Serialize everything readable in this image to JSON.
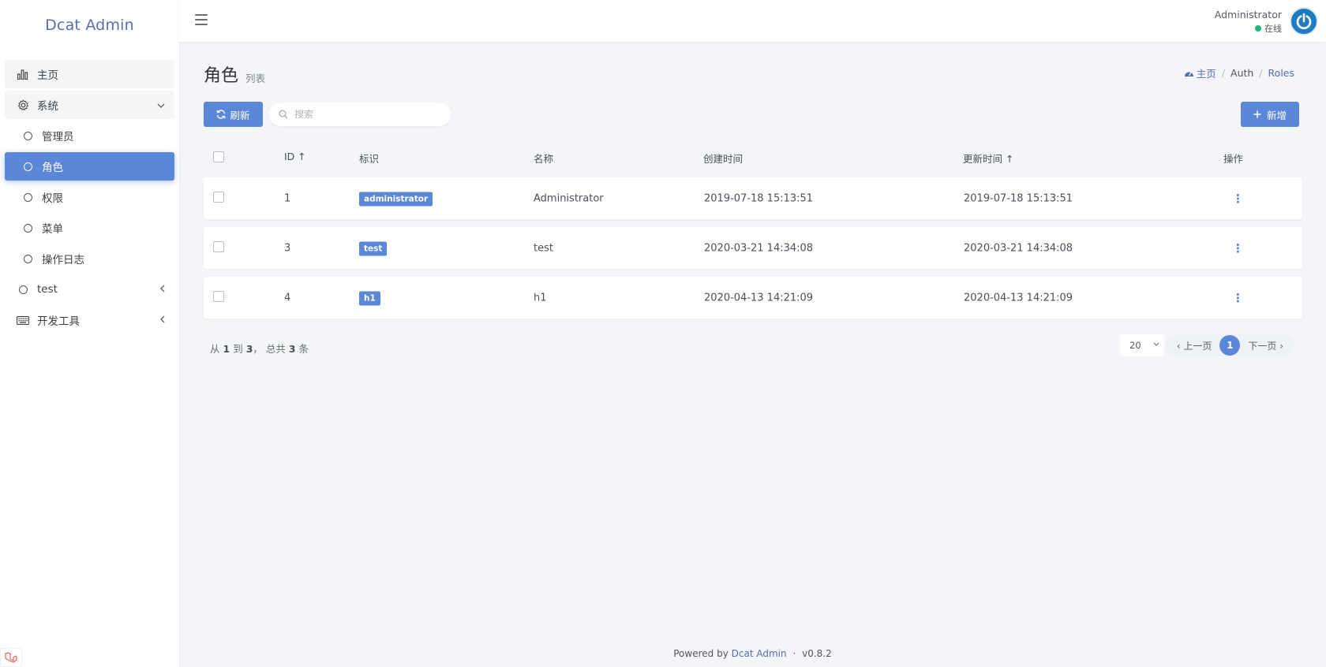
{
  "app": {
    "brand": "Dcat Admin"
  },
  "sidebar": {
    "items": [
      {
        "label": "主页",
        "icon": "bar-chart-icon"
      },
      {
        "label": "系统",
        "icon": "gear-icon"
      },
      {
        "label": "管理员"
      },
      {
        "label": "角色"
      },
      {
        "label": "权限"
      },
      {
        "label": "菜单"
      },
      {
        "label": "操作日志"
      },
      {
        "label": "test"
      },
      {
        "label": "开发工具",
        "icon": "keyboard-icon"
      }
    ]
  },
  "header": {
    "user_name": "Administrator",
    "user_status": "在线"
  },
  "page": {
    "title": "角色",
    "subtitle": "列表"
  },
  "breadcrumb": {
    "home": "主页",
    "auth": "Auth",
    "current": "Roles",
    "sep": "/"
  },
  "toolbar": {
    "refresh_label": "刷新",
    "search_placeholder": "搜索",
    "add_label": "新增"
  },
  "table": {
    "columns": {
      "id": "ID ↑",
      "slug": "标识",
      "name": "名称",
      "created": "创建时间",
      "updated": "更新时间 ↑",
      "actions": "操作"
    },
    "rows": [
      {
        "id": "1",
        "slug": "administrator",
        "name": "Administrator",
        "created": "2019-07-18 15:13:51",
        "updated": "2019-07-18 15:13:51"
      },
      {
        "id": "3",
        "slug": "test",
        "name": "test",
        "created": "2020-03-21 14:34:08",
        "updated": "2020-03-21 14:34:08"
      },
      {
        "id": "4",
        "slug": "h1",
        "name": "h1",
        "created": "2020-04-13 14:21:09",
        "updated": "2020-04-13 14:21:09"
      }
    ]
  },
  "pagination": {
    "summary_from": "从",
    "summary_start": "1",
    "summary_to": "到",
    "summary_end": "3",
    "summary_total_prefix": "， 总共",
    "summary_total": "3",
    "summary_unit": "条",
    "per_page": "20",
    "prev": "上一页",
    "current": "1",
    "next": "下一页"
  },
  "footer": {
    "powered_by": "Powered by",
    "link": "Dcat Admin",
    "dot": "·",
    "version": "v0.8.2"
  },
  "colors": {
    "primary": "#5b87d8",
    "brand": "#586cb1",
    "online": "#21b978",
    "avatar": "#1e7bc4"
  }
}
